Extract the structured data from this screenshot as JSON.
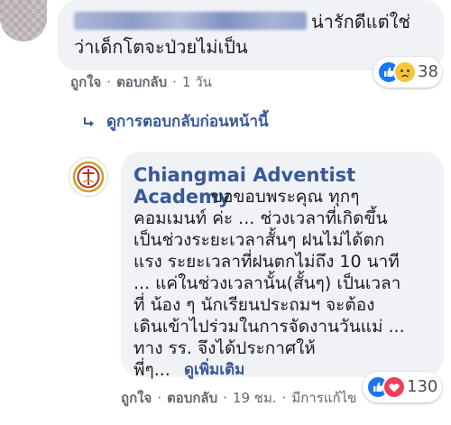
{
  "comment1": {
    "text_line1": "น่ารักดีแต่ใช่",
    "text_line2": "ว่าเด็กโตจะป่วยไม่เป็น",
    "reactions": {
      "icons": [
        "like-icon",
        "sad-icon"
      ],
      "count": "38"
    },
    "actions": {
      "like": "ถูกใจ",
      "reply": "ตอบกลับ",
      "time": "1 วัน",
      "separator": "·"
    }
  },
  "replies_link": "ดูการตอบกลับก่อนหน้านี้",
  "comment2": {
    "author_line1": "Chiangmai Adventist",
    "author_line2": "Academy",
    "body": [
      "ขอขอบพระคุณ ทุกๆ",
      "คอมเมนท์ ค่ะ ... ช่วงเวลาที่เกิดขึ้น",
      "เป็นช่วงระยะเวลาสั้นๆ ฝนไม่ได้ตก",
      "แรง ระยะเวลาที่ฝนตกไม่ถึง 10 นาที",
      "... แค่ในช่วงเวลานั้น(สั้นๆ) เป็นเวลา",
      "ที่ น้อง ๆ นักเรียนประถมฯ จะต้อง",
      "เดินเข้าไปร่วมในการจัดงานวันแม่ ...",
      "ทาง รร. จึงได้ประกาศให้",
      "พี่ๆ..."
    ],
    "see_more": "ดูเพิ่มเติม",
    "reactions": {
      "icons": [
        "like-icon",
        "love-icon"
      ],
      "count": "130"
    },
    "actions": {
      "like": "ถูกใจ",
      "reply": "ตอบกลับ",
      "time": "19 ชม.",
      "extra": "มีการแก้ไข",
      "separator": "·"
    }
  },
  "colors": {
    "link": "#385898",
    "bubble": "#f0f2f5",
    "meta": "#606770",
    "like": "#1877f2",
    "love": "#f33e58",
    "sad": "#f7c43b"
  }
}
